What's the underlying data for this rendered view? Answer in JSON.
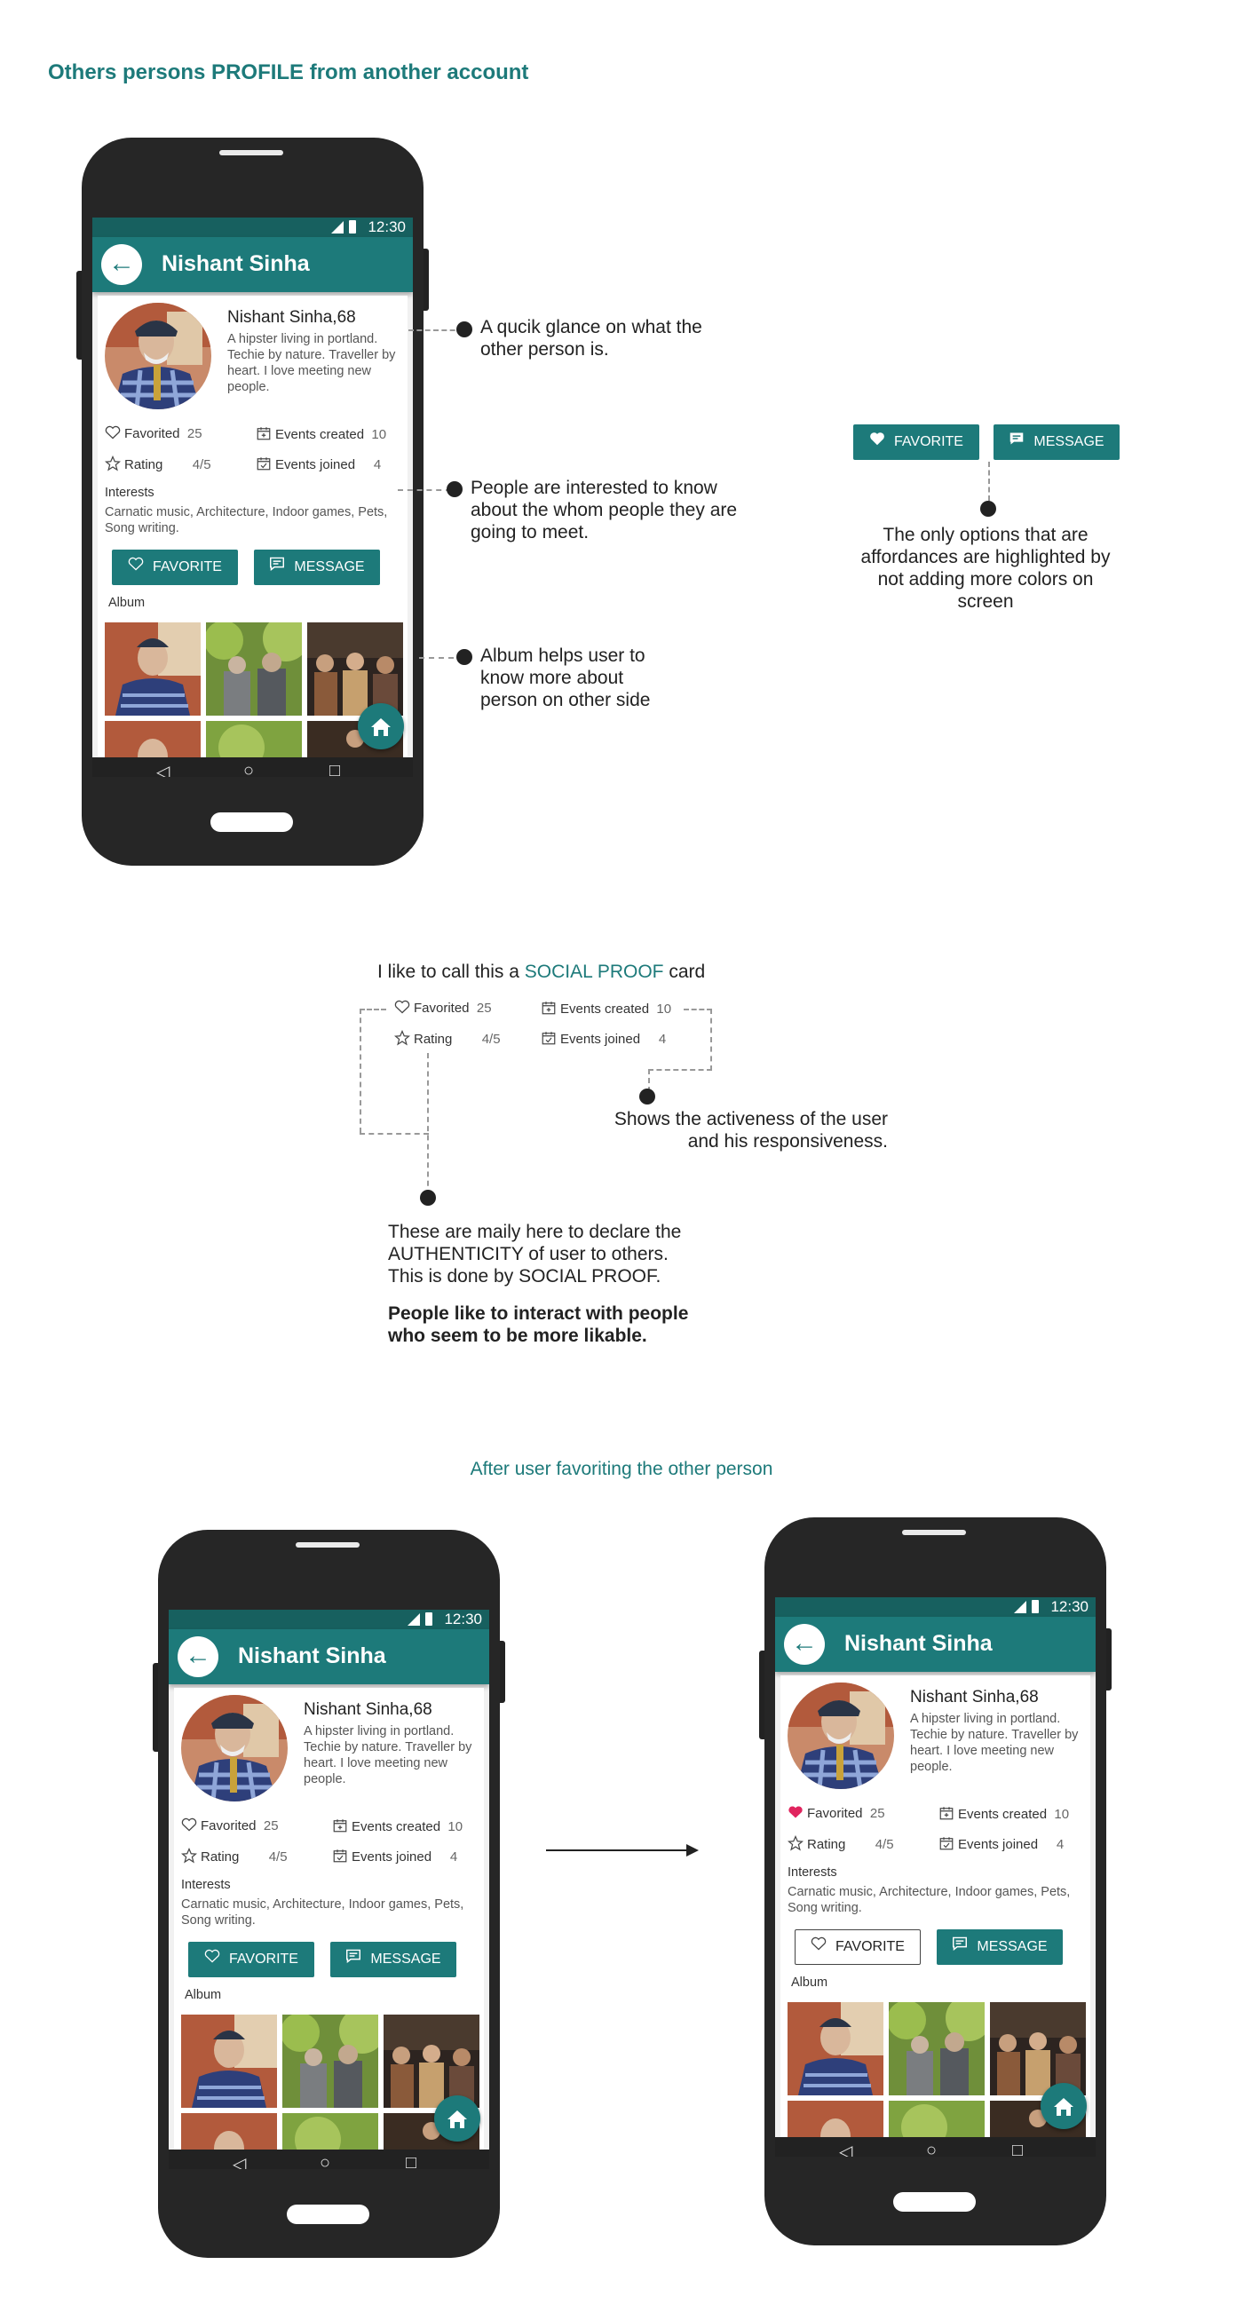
{
  "page_title": "Others persons PROFILE from another account",
  "colors": {
    "accent": "#1d7a7a",
    "status_bar": "#17605f",
    "favorited_heart": "#e0245e"
  },
  "phone": {
    "status_time": "12:30",
    "app_title": "Nishant Sinha",
    "profile_name": "Nishant Sinha,68",
    "bio": "A hipster living in portland. Techie by nature. Traveller by heart. I love meeting new people.",
    "stats": {
      "favorited_label": "Favorited",
      "favorited_value": "25",
      "rating_label": "Rating",
      "rating_value": "4/5",
      "events_created_label": "Events created",
      "events_created_value": "10",
      "events_joined_label": "Events joined",
      "events_joined_value": "4"
    },
    "interests_label": "Interests",
    "interests": "Carnatic music, Architecture, Indoor games, Pets, Song writing.",
    "favorite_button": "FAVORITE",
    "message_button": "MESSAGE",
    "album_label": "Album"
  },
  "annotations": {
    "glance": "A qucik glance on what the other person is.",
    "interests": "People are interested to know about the whom people they are going to meet.",
    "album": "Album helps user to know more about person on other side",
    "affordance": "The only options that are affordances are highlighted by not adding more colors on screen",
    "social_proof_prefix": "I like to call this a ",
    "social_proof_highlight": "SOCIAL PROOF",
    "social_proof_suffix": " card",
    "activeness": "Shows the activeness of the user and his responsiveness.",
    "authenticity": "These are maily here to declare the AUTHENTICITY of user to others. This is done by SOCIAL PROOF.",
    "likable": "People like to interact with people who seem to be more likable.",
    "after_favoriting": "After user favoriting the other person"
  }
}
